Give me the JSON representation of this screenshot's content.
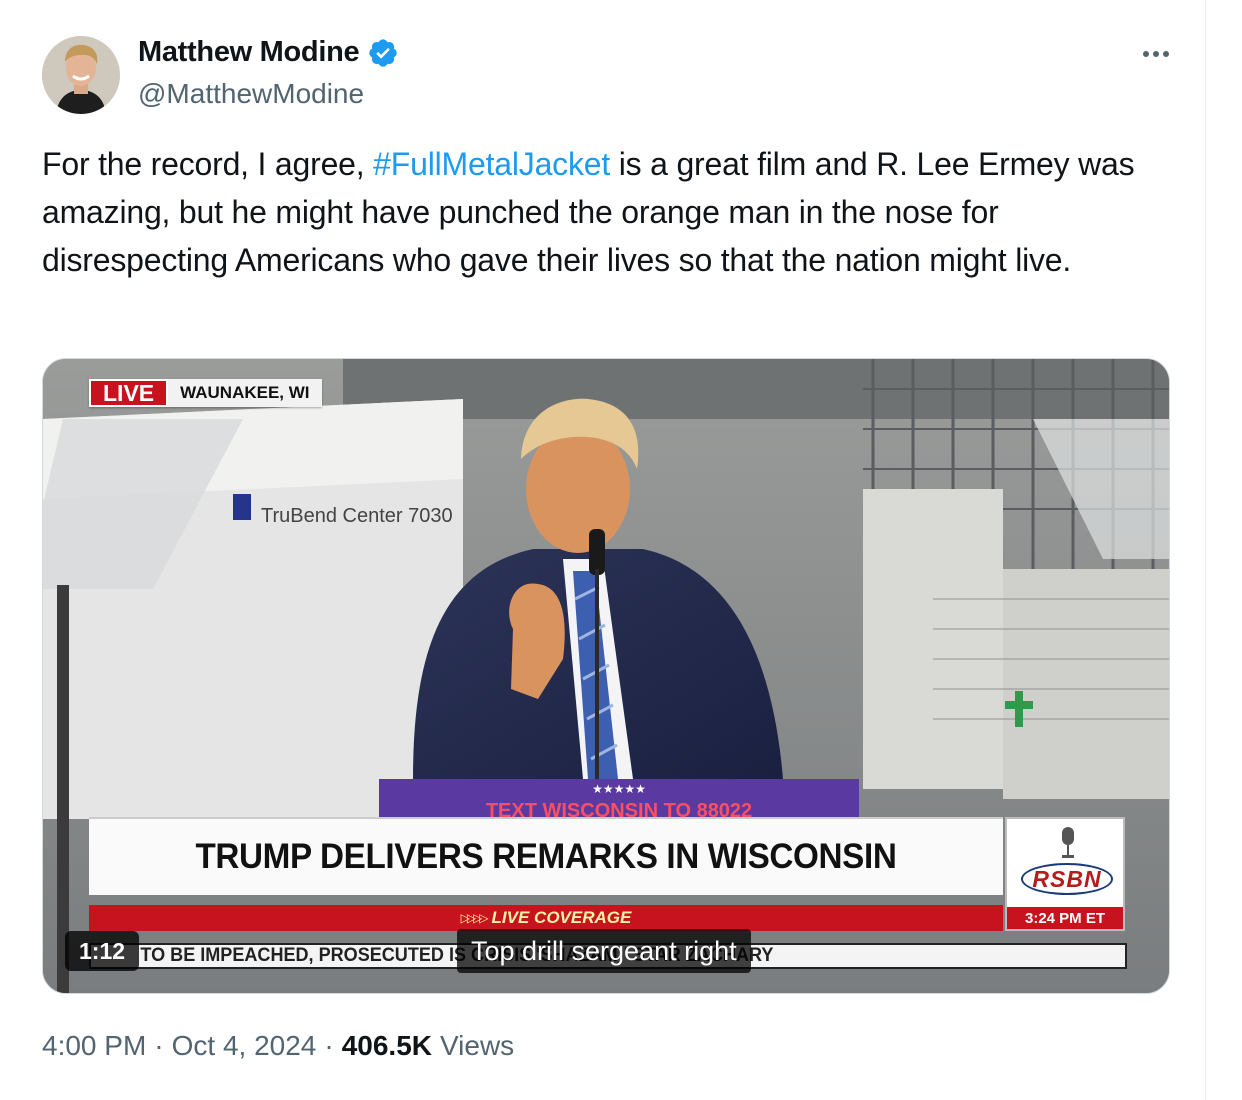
{
  "author": {
    "display_name": "Matthew Modine",
    "handle": "@MatthewModine",
    "verified": true
  },
  "tweet": {
    "text_before": "For the record, I agree, ",
    "hashtag": "#FullMetalJacket",
    "text_after": " is a great film and R. Lee Ermey was amazing, but he might have punched the orange man in the nose for disrespecting Americans who gave their lives so that the nation might live."
  },
  "media": {
    "live_label": "LIVE",
    "location": "WAUNAKEE, WI",
    "machine_label": "TruBend Center 7030",
    "podium_stars": "★★★★★",
    "podium_text": "TEXT WISCONSIN TO 88022",
    "headline": "TRUMP DELIVERS REMARKS IN WISCONSIN",
    "subbar": "LIVE COVERAGE",
    "network": "RSBN",
    "time": "3:24 PM ET",
    "ticker": "TO BE IMPEACHED, PROSECUTED        IS CRISIS     'SHAZAM!' STAR ZACHARY",
    "ticker_left": "RRIS",
    "duration": "1:12",
    "caption": "Top drill sergeant right"
  },
  "meta": {
    "time": "4:00 PM",
    "date": "Oct 4, 2024",
    "views_count": "406.5K",
    "views_label": "Views",
    "separator": "·"
  },
  "colors": {
    "link": "#1d9bf0",
    "secondary_text": "#536471",
    "verified_badge": "#1d9bf0",
    "live_red": "#c7131d"
  }
}
